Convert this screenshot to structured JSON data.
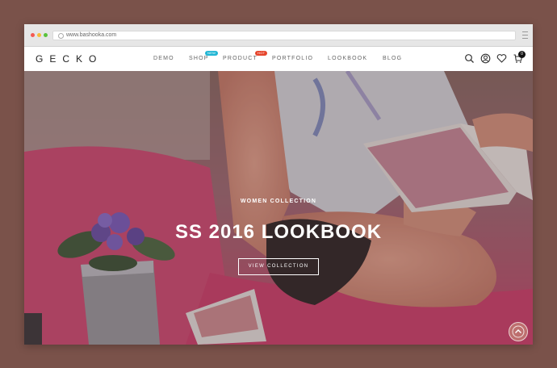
{
  "browser": {
    "url": "www.bashooka.com",
    "dot_colors": [
      "#f45a52",
      "#f6bc3a",
      "#59c23c"
    ]
  },
  "header": {
    "logo": "GECKO",
    "nav": [
      {
        "label": "DEMO"
      },
      {
        "label": "SHOP",
        "badge": "NEW",
        "badge_color": "#21b6d4"
      },
      {
        "label": "PRODUCT",
        "badge": "HOT",
        "badge_color": "#e6452c"
      },
      {
        "label": "PORTFOLIO"
      },
      {
        "label": "LOOKBOOK"
      },
      {
        "label": "BLOG"
      }
    ],
    "icons": [
      "search-icon",
      "user-icon",
      "heart-icon",
      "cart-icon"
    ],
    "cart_count": "0"
  },
  "hero": {
    "eyebrow": "WOMEN COLLECTION",
    "title": "SS 2016 LOOKBOOK",
    "button": "VIEW COLLECTION"
  },
  "colors": {
    "background": "#7a524a",
    "hero_pink": "#d1456e",
    "accent_badge_new": "#21b6d4",
    "accent_badge_hot": "#e6452c"
  }
}
